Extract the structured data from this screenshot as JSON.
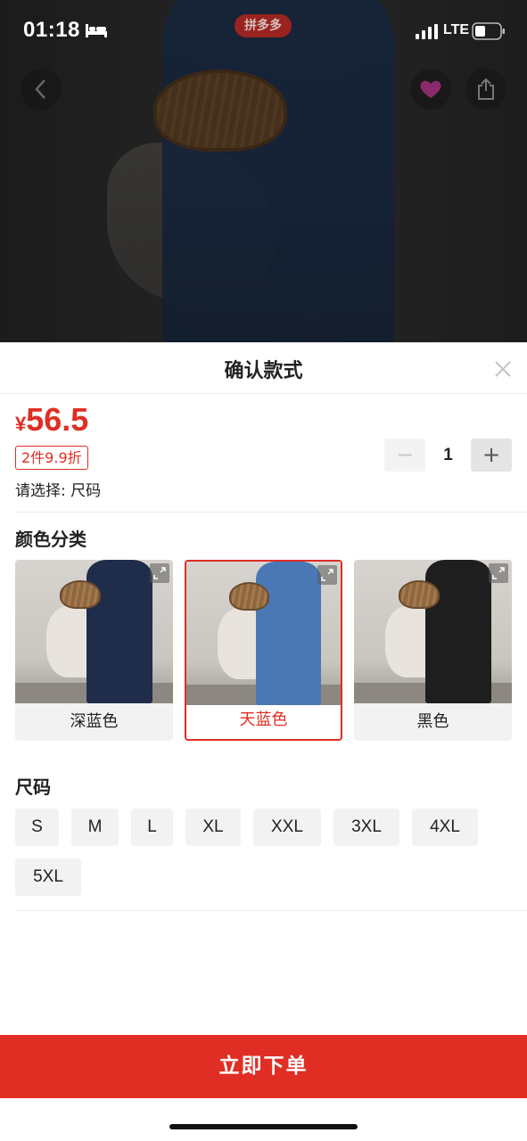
{
  "status_bar": {
    "time": "01:18",
    "network": "LTE"
  },
  "header_badge": "拼多多",
  "sheet": {
    "title": "确认款式",
    "price_currency": "¥",
    "price_value": "56.5",
    "discount_tag": "2件9.9折",
    "select_hint": "请选择: 尺码",
    "quantity": "1",
    "minus_label": "−",
    "plus_label": "+"
  },
  "color_section": {
    "label": "颜色分类",
    "options": [
      {
        "label": "深蓝色",
        "dress_color": "#1f2d4a",
        "selected": false
      },
      {
        "label": "天蓝色",
        "dress_color": "#4a78b4",
        "selected": true
      },
      {
        "label": "黑色",
        "dress_color": "#1e1e1e",
        "selected": false
      }
    ]
  },
  "size_section": {
    "label": "尺码",
    "options": [
      "S",
      "M",
      "L",
      "XL",
      "XXL",
      "3XL",
      "4XL",
      "5XL"
    ]
  },
  "order_button": "立即下单",
  "colors": {
    "accent": "#e02e24",
    "chip_bg": "#f2f2f2"
  }
}
